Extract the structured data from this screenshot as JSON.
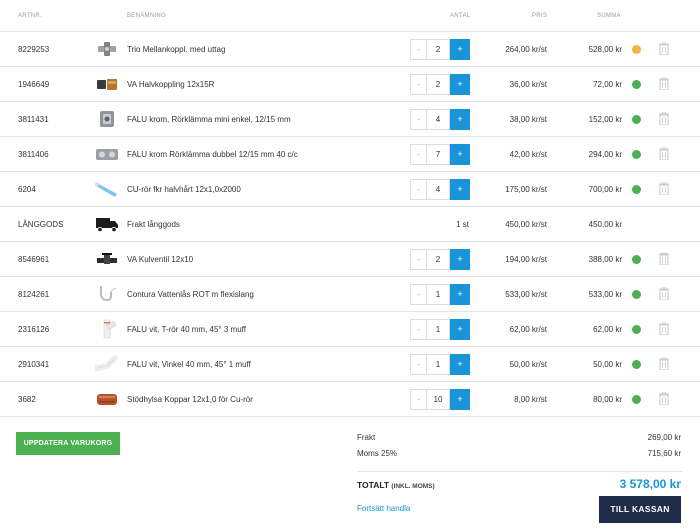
{
  "header": {
    "artnr": "ARTNR.",
    "benamning": "BENÄMNING",
    "antal": "ANTAL",
    "pris": "PRIS",
    "summa": "SUMMA"
  },
  "colors": {
    "accent": "#1a94d8",
    "green": "#4caf50",
    "orange": "#f5b342",
    "navy": "#1f2d4a"
  },
  "rows": [
    {
      "artnr": "8229253",
      "name": "Trio Mellankoppl. med uttag",
      "qty": "2",
      "pris": "264,00 kr/st",
      "summa": "528,00 kr",
      "status": "orange",
      "icon": "fitting-tee-icon"
    },
    {
      "artnr": "1946649",
      "name": "VA Halvkoppling 12x15R",
      "qty": "2",
      "pris": "36,00 kr/st",
      "summa": "72,00 kr",
      "status": "green",
      "icon": "coupling-icon"
    },
    {
      "artnr": "3811431",
      "name": "FALU krom, Rörklämma mini enkel, 12/15 mm",
      "qty": "4",
      "pris": "38,00 kr/st",
      "summa": "152,00 kr",
      "status": "green",
      "icon": "pipe-clamp-icon"
    },
    {
      "artnr": "3811406",
      "name": "FALU krom Rörklämma dubbel 12/15 mm 40 c/c",
      "qty": "7",
      "pris": "42,00 kr/st",
      "summa": "294,00 kr",
      "status": "green",
      "icon": "double-clamp-icon"
    },
    {
      "artnr": "6204",
      "name": "CU-rör fkr halvhårt 12x1,0x2000",
      "qty": "4",
      "pris": "175,00 kr/st",
      "summa": "700,00 kr",
      "status": "green",
      "icon": "copper-pipe-icon"
    },
    {
      "artnr": "LÅNGGODS",
      "name": "Frakt långgods",
      "qtytext": "1 st",
      "pris": "450,00 kr/st",
      "summa": "450,00 kr",
      "status": "",
      "icon": "truck-icon"
    },
    {
      "artnr": "8546961",
      "name": "VA Kulventil 12x10",
      "qty": "2",
      "pris": "194,00 kr/st",
      "summa": "388,00 kr",
      "status": "green",
      "icon": "ball-valve-icon"
    },
    {
      "artnr": "8124261",
      "name": "Contura Vattenlås ROT m flexislang",
      "qty": "1",
      "pris": "533,00 kr/st",
      "summa": "533,00 kr",
      "status": "green",
      "icon": "water-trap-icon"
    },
    {
      "artnr": "2316126",
      "name": "FALU vit, T-rör 40 mm, 45° 3 muff",
      "qty": "1",
      "pris": "62,00 kr/st",
      "summa": "62,00 kr",
      "status": "green",
      "icon": "t-pipe-icon"
    },
    {
      "artnr": "2910341",
      "name": "FALU vit, Vinkel 40 mm, 45° 1 muff",
      "qty": "1",
      "pris": "50,00 kr/st",
      "summa": "50,00 kr",
      "status": "green",
      "icon": "elbow-pipe-icon"
    },
    {
      "artnr": "3682",
      "name": "Stödhylsa Koppar 12x1,0 för Cu-rör",
      "qty": "10",
      "pris": "8,00 kr/st",
      "summa": "80,00 kr",
      "status": "green",
      "icon": "support-sleeve-icon"
    }
  ],
  "qty_minus": "-",
  "qty_plus": "+",
  "update_button": "UPPDATERA VARUKORG",
  "summary": {
    "frakt_label": "Frakt",
    "frakt_value": "269,00 kr",
    "moms_label": "Moms 25%",
    "moms_value": "715,60 kr",
    "total_label": "TOTALT",
    "total_sub": "(INKL. MOMS)",
    "total_value": "3 578,00 kr"
  },
  "continue_link": "Fortsätt handla",
  "checkout_button": "TILL KASSAN"
}
